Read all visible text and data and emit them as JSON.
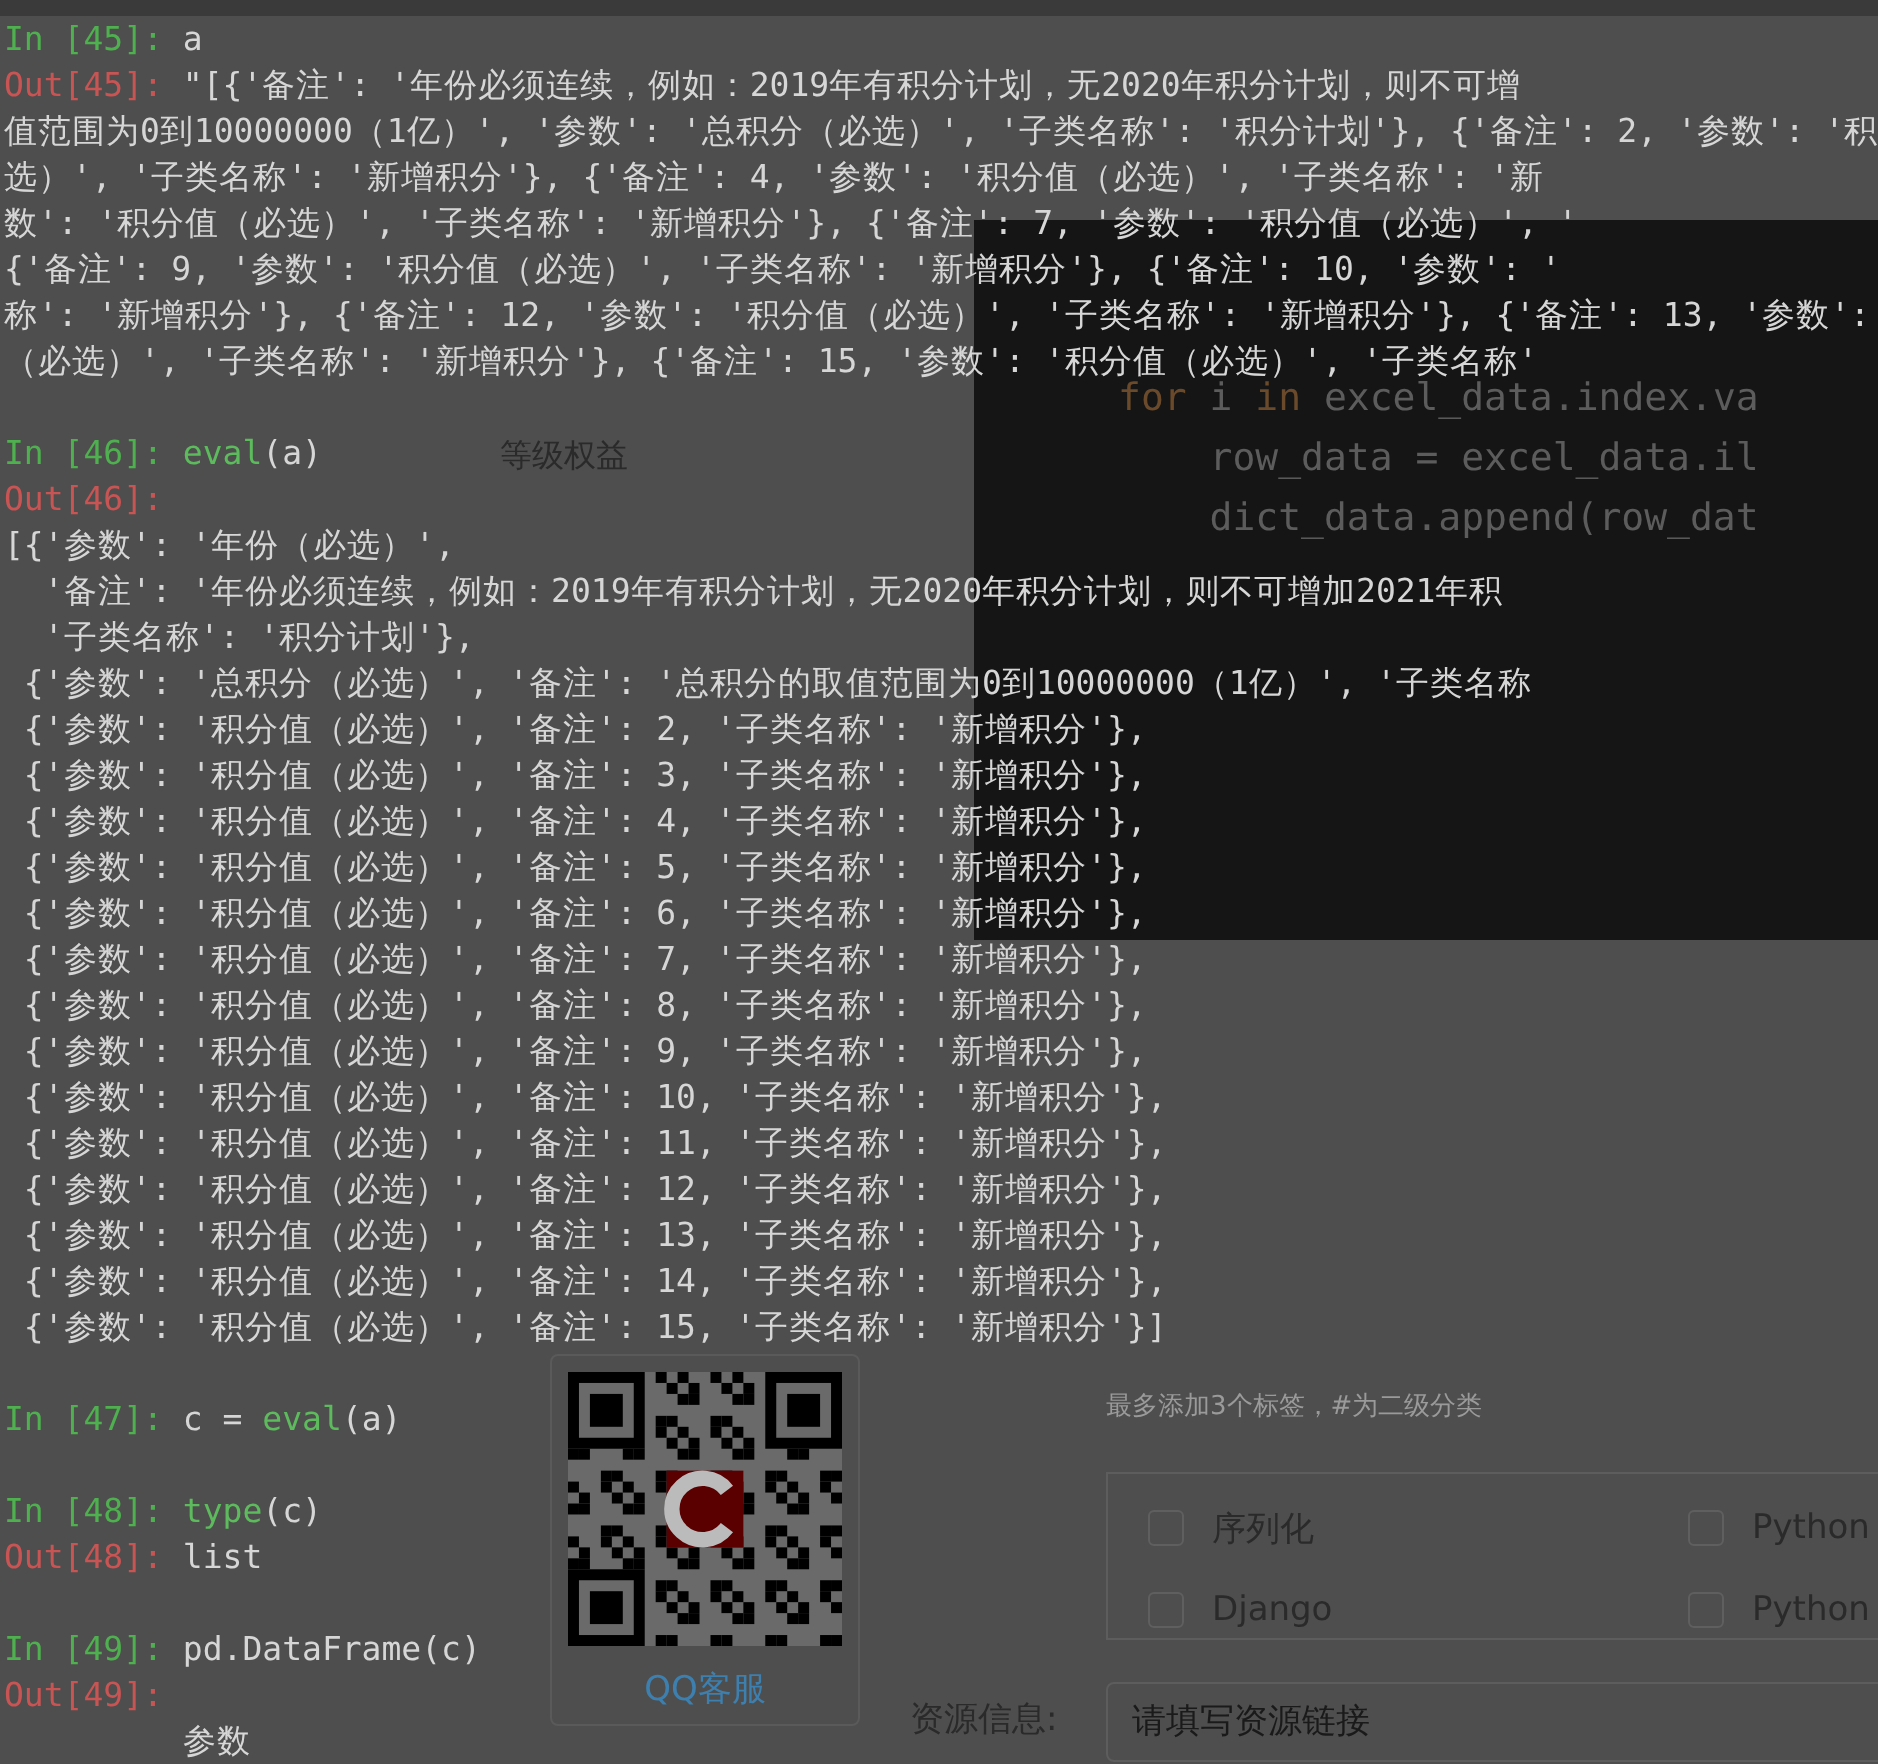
{
  "console": {
    "lines": [
      {
        "kind": "in",
        "prompt": "In [45]: ",
        "segments": [
          {
            "kind": "plain",
            "text": "a"
          }
        ]
      },
      {
        "kind": "out",
        "prompt": "Out[45]: ",
        "text": "\"[{'备注': '年份必须连续，例如：2019年有积分计划，无2020年积分计划，则不可增"
      },
      {
        "kind": "text",
        "text": "值范围为0到10000000（1亿）', '参数': '总积分（必选）', '子类名称': '积分计划'}, {'备注': 2, '参数': '积"
      },
      {
        "kind": "text",
        "text": "选）', '子类名称': '新增积分'}, {'备注': 4, '参数': '积分值（必选）', '子类名称': '新"
      },
      {
        "kind": "text",
        "text": "数': '积分值（必选）', '子类名称': '新增积分'}, {'备注': 7, '参数': '积分值（必选）', '"
      },
      {
        "kind": "text",
        "text": "{'备注': 9, '参数': '积分值（必选）', '子类名称': '新增积分'}, {'备注': 10, '参数': '"
      },
      {
        "kind": "text",
        "text": "称': '新增积分'}, {'备注': 12, '参数': '积分值（必选）', '子类名称': '新增积分'}, {'备注': 13, '参数':"
      },
      {
        "kind": "text",
        "text": "（必选）', '子类名称': '新增积分'}, {'备注': 15, '参数': '积分值（必选）', '子类名称'"
      },
      {
        "kind": "blank"
      },
      {
        "kind": "in",
        "prompt": "In [46]: ",
        "segments": [
          {
            "kind": "builtin",
            "text": "eval"
          },
          {
            "kind": "plain",
            "text": "(a)"
          }
        ]
      },
      {
        "kind": "out",
        "prompt": "Out[46]: "
      },
      {
        "kind": "text",
        "text": "[{'参数': '年份（必选）',"
      },
      {
        "kind": "text",
        "text": "  '备注': '年份必须连续，例如：2019年有积分计划，无2020年积分计划，则不可增加2021年积"
      },
      {
        "kind": "text",
        "text": "  '子类名称': '积分计划'},"
      },
      {
        "kind": "text",
        "text": " {'参数': '总积分（必选）', '备注': '总积分的取值范围为0到10000000（1亿）', '子类名称"
      },
      {
        "kind": "text",
        "text": " {'参数': '积分值（必选）', '备注': 2, '子类名称': '新增积分'},"
      },
      {
        "kind": "text",
        "text": " {'参数': '积分值（必选）', '备注': 3, '子类名称': '新增积分'},"
      },
      {
        "kind": "text",
        "text": " {'参数': '积分值（必选）', '备注': 4, '子类名称': '新增积分'},"
      },
      {
        "kind": "text",
        "text": " {'参数': '积分值（必选）', '备注': 5, '子类名称': '新增积分'},"
      },
      {
        "kind": "text",
        "text": " {'参数': '积分值（必选）', '备注': 6, '子类名称': '新增积分'},"
      },
      {
        "kind": "text",
        "text": " {'参数': '积分值（必选）', '备注': 7, '子类名称': '新增积分'},"
      },
      {
        "kind": "text",
        "text": " {'参数': '积分值（必选）', '备注': 8, '子类名称': '新增积分'},"
      },
      {
        "kind": "text",
        "text": " {'参数': '积分值（必选）', '备注': 9, '子类名称': '新增积分'},"
      },
      {
        "kind": "text",
        "text": " {'参数': '积分值（必选）', '备注': 10, '子类名称': '新增积分'},"
      },
      {
        "kind": "text",
        "text": " {'参数': '积分值（必选）', '备注': 11, '子类名称': '新增积分'},"
      },
      {
        "kind": "text",
        "text": " {'参数': '积分值（必选）', '备注': 12, '子类名称': '新增积分'},"
      },
      {
        "kind": "text",
        "text": " {'参数': '积分值（必选）', '备注': 13, '子类名称': '新增积分'},"
      },
      {
        "kind": "text",
        "text": " {'参数': '积分值（必选）', '备注': 14, '子类名称': '新增积分'},"
      },
      {
        "kind": "text",
        "text": " {'参数': '积分值（必选）', '备注': 15, '子类名称': '新增积分'}]"
      },
      {
        "kind": "blank"
      },
      {
        "kind": "in",
        "prompt": "In [47]: ",
        "segments": [
          {
            "kind": "plain",
            "text": "c = "
          },
          {
            "kind": "builtin",
            "text": "eval"
          },
          {
            "kind": "plain",
            "text": "(a)"
          }
        ]
      },
      {
        "kind": "blank"
      },
      {
        "kind": "in",
        "prompt": "In [48]: ",
        "segments": [
          {
            "kind": "builtin",
            "text": "type"
          },
          {
            "kind": "plain",
            "text": "(c)"
          }
        ]
      },
      {
        "kind": "out",
        "prompt": "Out[48]: ",
        "text": "list"
      },
      {
        "kind": "blank"
      },
      {
        "kind": "in",
        "prompt": "In [49]: ",
        "segments": [
          {
            "kind": "plain",
            "text": "pd.DataFrame(c)"
          }
        ]
      },
      {
        "kind": "out",
        "prompt": "Out[49]: "
      },
      {
        "kind": "text",
        "text": "         参数"
      }
    ]
  },
  "code_panel": {
    "lines": [
      {
        "segments": [
          {
            "kind": "keyword",
            "text": "for"
          },
          {
            "kind": "plain",
            "text": " i "
          },
          {
            "kind": "keyword",
            "text": "in"
          },
          {
            "kind": "plain",
            "text": " excel_data.index.va"
          }
        ]
      },
      {
        "segments": [
          {
            "kind": "plain",
            "text": "    row_data = excel_data.il"
          }
        ]
      },
      {
        "segments": [
          {
            "kind": "plain",
            "text": "    dict_data.append(row_dat"
          }
        ]
      }
    ]
  },
  "sidebar": {
    "items": [
      {
        "label": "等级权益"
      }
    ]
  },
  "qr_card": {
    "caption": "QQ客服"
  },
  "tags": {
    "hint": "最多添加3个标签，#为二级分类"
  },
  "categories": [
    {
      "label": "序列化",
      "checked": false
    },
    {
      "label": "Python",
      "checked": false
    },
    {
      "label": "Django",
      "checked": false
    },
    {
      "label": "Python",
      "checked": false
    }
  ],
  "resource": {
    "label": "资源信息:",
    "placeholder": "请填写资源链接"
  }
}
